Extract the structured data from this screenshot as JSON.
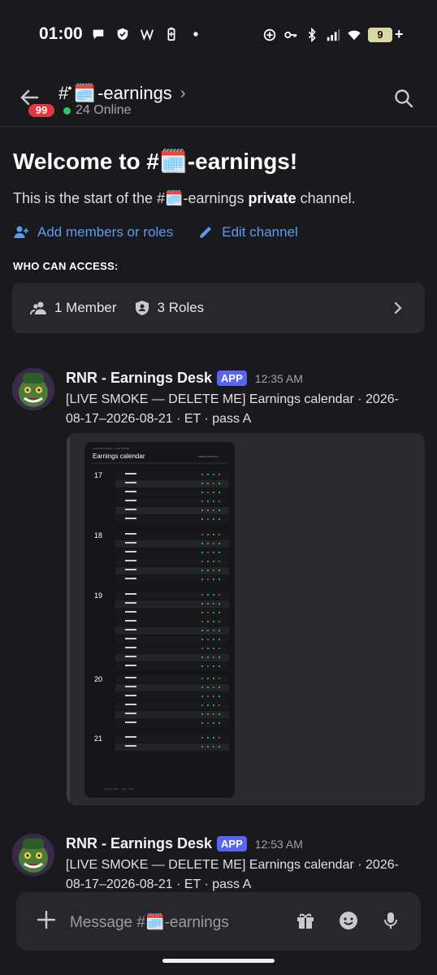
{
  "status_bar": {
    "time": "01:00",
    "battery": "9"
  },
  "header": {
    "channel_hash": "#",
    "channel_emoji": "🗓️",
    "channel_name": "-earnings",
    "online": "24 Online",
    "unread_badge": "99"
  },
  "welcome": {
    "title": "Welcome to #🗓️-earnings!",
    "sub_before": "This is the start of the #🗓️-earnings ",
    "sub_bold": "private",
    "sub_after": " channel.",
    "add_members": "Add members or roles",
    "edit_channel": "Edit channel",
    "who_can_access": "WHO CAN ACCESS:",
    "members": "1 Member",
    "roles": "3 Roles"
  },
  "messages": [
    {
      "author": "RNR - Earnings Desk",
      "tag": "APP",
      "time": "12:35 AM",
      "text": "[LIVE SMOKE — DELETE ME] Earnings calendar · 2026-08-17–2026-08-21 · ET · pass A"
    },
    {
      "author": "RNR - Earnings Desk",
      "tag": "APP",
      "time": "12:53 AM",
      "text": "[LIVE SMOKE — DELETE ME] Earnings calendar · 2026-08-17–2026-08-21 · ET · pass A"
    }
  ],
  "calendar_image": {
    "title": "Earnings calendar",
    "days": [
      "17",
      "18",
      "19",
      "20",
      "21"
    ]
  },
  "composer": {
    "placeholder": "Message #🗓️-earnings"
  },
  "colors": {
    "accent": "#5865f2",
    "link": "#5b9bf0",
    "online": "#2dc770",
    "badge": "#e3363f"
  }
}
